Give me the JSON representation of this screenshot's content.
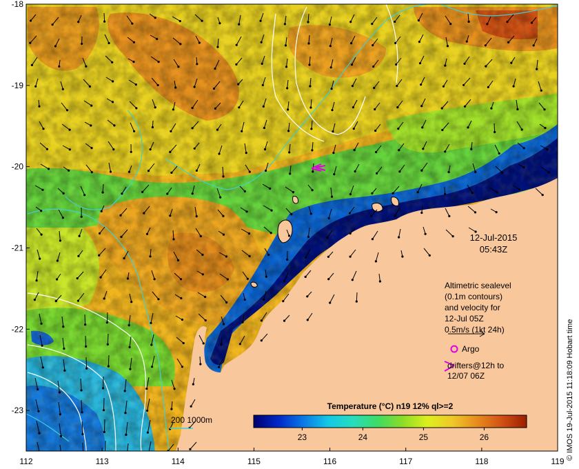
{
  "map": {
    "lon_range": [
      112,
      119
    ],
    "lat_range": [
      -23.5,
      -18
    ],
    "lon_ticks": [
      "112",
      "113",
      "114",
      "115",
      "116",
      "117",
      "118",
      "119"
    ],
    "lat_ticks": [
      "-18",
      "-19",
      "-20",
      "-21",
      "-22",
      "-23"
    ],
    "land_color": "#f9c79c",
    "deep_water_color": "#00107a",
    "contour_color": "#40d0d0",
    "sealevel_contour_color": "#ffffff",
    "arrow_color": "#000000",
    "argo_color": "#e000e0",
    "drifter_color": "#e000e0"
  },
  "date_stamp": {
    "date": "12-Jul-2015",
    "time": "05:43Z"
  },
  "legend": {
    "line1": "Altimetric sealevel",
    "line2": "(0.1m contours)",
    "line3": "and velocity for",
    "line4": "12-Jul 05Z",
    "line5": "0.5m/s (1kt 24h)",
    "argo_label": "Argo",
    "argo_icon": "circle-icon",
    "drifter_label1": "drifters@12h to",
    "drifter_label2": "12/07 06Z",
    "drifter_icon": "chevron-icon"
  },
  "bathymetry_key": {
    "label": "200  1000m"
  },
  "colorbar": {
    "title": "Temperature (°C) n19 12% ql>=2",
    "ticks": [
      "23",
      "24",
      "25",
      "26"
    ],
    "tick_values": [
      23,
      24,
      25,
      26
    ],
    "range": [
      22.2,
      26.7
    ],
    "stops": [
      "#00006e",
      "#0028c8",
      "#0a78e6",
      "#14c8e6",
      "#28dcbe",
      "#3cdc64",
      "#8cdc28",
      "#dcf01e",
      "#f0c828",
      "#e68c1e",
      "#d25014",
      "#9b1e00"
    ]
  },
  "credit": "© IMOS 19-Jul-2015 11:18:09 Hobart time"
}
